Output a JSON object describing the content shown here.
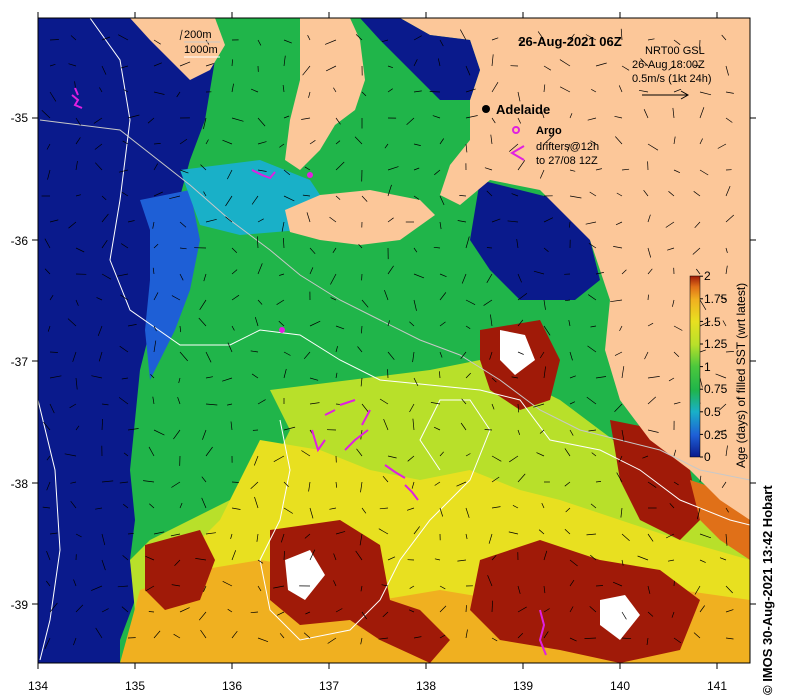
{
  "title": "26-Aug-2021 06Z",
  "depth_legend": {
    "contour_1": "200m",
    "contour_2": "1000m"
  },
  "current_legend": {
    "product": "NRT00 GSL",
    "time": "26-Aug 18:00Z",
    "scale": "0.5m/s (1kt 24h)"
  },
  "place": {
    "name": "Adelaide"
  },
  "symbols": {
    "argo": "Argo",
    "drifters_line1": "drifters@12h",
    "drifters_line2": "to 27/08 12Z"
  },
  "axes": {
    "x_ticks": [
      "134",
      "135",
      "136",
      "137",
      "138",
      "139",
      "140",
      "141"
    ],
    "y_ticks": [
      "-35",
      "-36",
      "-37",
      "-38",
      "-39"
    ]
  },
  "colorbar": {
    "label": "Age (days) of filled SST (wrt latest)",
    "ticks": [
      "0",
      "0.25",
      "0.5",
      "0.75",
      "1",
      "1.25",
      "1.5",
      "1.75",
      "2"
    ],
    "colors": [
      "#0a1a8c",
      "#1e5fd6",
      "#19b0c8",
      "#20b54a",
      "#4cc83c",
      "#b8e02a",
      "#e8e020",
      "#f0b020",
      "#e07018",
      "#a01a08"
    ]
  },
  "credit": "© IMOS 30-Aug-2021 13:42 Hobart",
  "colors": {
    "land": "#fcc799",
    "deep_ocean": "#0a1a8c",
    "argo": "#e020e0",
    "drifter": "#e020e0"
  }
}
